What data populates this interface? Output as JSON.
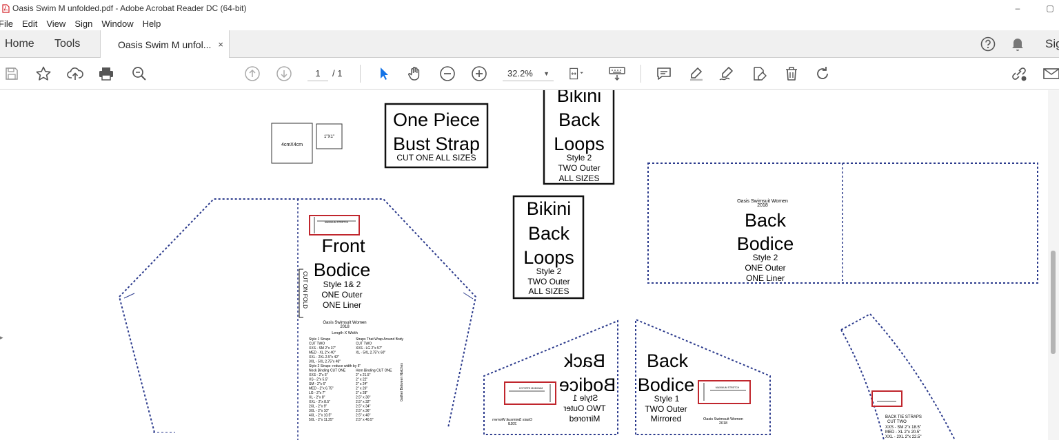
{
  "window": {
    "title": "Oasis Swim M unfolded.pdf - Adobe Acrobat Reader DC (64-bit)",
    "minimize_glyph": "–",
    "maximize_glyph": "▢"
  },
  "menu": [
    "File",
    "Edit",
    "View",
    "Sign",
    "Window",
    "Help"
  ],
  "tabs": {
    "home": "Home",
    "tools": "Tools",
    "document": "Oasis Swim M unfol...",
    "close_glyph": "×",
    "sign": "Sig"
  },
  "toolbar": {
    "page_current": "1",
    "page_total": "/ 1",
    "zoom": "32.2%",
    "zoom_caret": "▼"
  },
  "colors": {
    "accent": "#1473e6",
    "pattern_line": "#2b3a8c",
    "grain_box": "#c0262d",
    "ui_gray": "#5a5a5a"
  },
  "pattern": {
    "square_4cm": "4cmX4cm",
    "square_1in": "1\"X1\"",
    "one_piece": {
      "line1": "One Piece",
      "line2": "Bust Strap",
      "note": "CUT ONE ALL SIZES"
    },
    "bikini_top": {
      "line1": "Bikini",
      "line2": "Back",
      "line3": "Loops",
      "style": "Style 2",
      "cut": "TWO Outer",
      "sizes": "ALL SIZES"
    },
    "bikini_mid": {
      "line1": "Bikini",
      "line2": "Back",
      "line3": "Loops",
      "style": "Style 2",
      "cut": "TWO Outer",
      "sizes": "ALL SIZES"
    },
    "back_bodice_2": {
      "brand": "Oasis Swimsuit Women",
      "year": "2018",
      "line1": "Back",
      "line2": "Bodice",
      "style": "Style 2",
      "cut1": "ONE Outer",
      "cut2": "ONE Liner"
    },
    "front_bodice": {
      "line1": "Front",
      "line2": "Bodice",
      "style": "Style 1& 2",
      "cut1": "ONE Outer",
      "cut2": "ONE Liner",
      "fold": "CUT ON FOLD",
      "brand": "Oasis Swimsuit Women",
      "year": "2018",
      "dims": "Length X Width",
      "stretch": "MAXIMUM STRETCH",
      "gather": "Gather Between Notches",
      "table_left": [
        "Style 1 Straps",
        "CUT TWO",
        "XXS - SM 2\"x 37\"",
        "MED - XL 2\"x 40\"",
        "XXL - 2XL 2.5\"x 42\"",
        "3XL - 5XL 2.75\"x 48\"",
        "Style 2 Straps- reduce width by 5\"",
        "Neck Binding CUT ONE",
        "XXS - 2\"x 5\"",
        "XS - 2\"x 5.5\"",
        "SM - 2\"x 6\"",
        "MED - 2\"x 6.75\"",
        "LG - 2\"x 7\"",
        "XL - 2\"x 8\"",
        "XXL - 2\"x 8.5\"",
        "2XL - 2\"x 9\"",
        "3XL - 2\"x 10\"",
        "4XL - 2\"x 10.5\"",
        "5XL - 2\"x 11.25\""
      ],
      "table_right": [
        "Straps That Wrap Around Body",
        "CUT TWO",
        "XXS - LG 2\"x 57\"",
        "XL - 5XL 2.75\"x 60\"",
        "",
        "",
        "",
        "Hem Binding CUT ONE",
        "2\" x 21.5\"",
        "2\" x 22\"",
        "2\" x 24\"",
        "2\" x 26\"",
        "2\" x 28\"",
        "2.5\" x 30\"",
        "2.5\" x 32\"",
        "2.5\" x 34\"",
        "2.5\" x 36\"",
        "2.5\" x 40\"",
        "2.5\" x 40.5\""
      ]
    },
    "back_bodice_mirror": {
      "line1": "Back",
      "line2": "Bodice",
      "style": "Style 1",
      "cut": "TWO Outer",
      "note": "Mirrored",
      "brand": "Oasis Swimsuit Women",
      "year": "2018",
      "stretch": "MAXIMUM STRETCH"
    },
    "back_bodice_1": {
      "line1": "Back",
      "line2": "Bodice",
      "style": "Style 1",
      "cut": "TWO Outer",
      "note": "Mirrored",
      "brand": "Oasis Swimsuit Women",
      "year": "2018",
      "stretch": "MAXIMUM STRETCH"
    },
    "tie_straps": {
      "title": "BACK TIE STRAPS",
      "cut": "CUT TWO",
      "rows": [
        "XXS - SM 2\"x 18.5\"",
        "MED - XL 2\"x 20.5\"",
        "XXL - 2XL 2\"x 22.5\""
      ]
    }
  }
}
